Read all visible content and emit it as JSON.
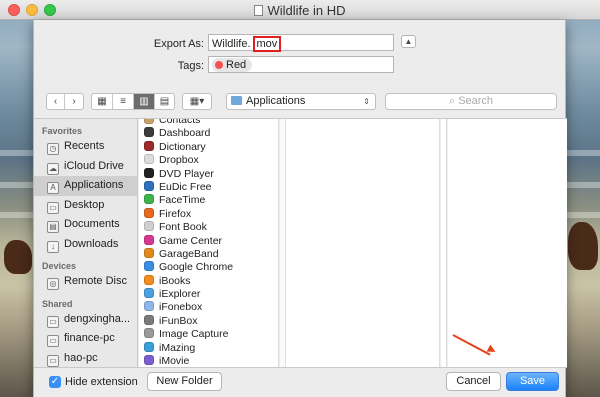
{
  "window": {
    "title": "Wildlife in HD"
  },
  "save": {
    "export_label": "Export As:",
    "filename_base": "Wildlife.",
    "filename_ext": "mov",
    "tags_label": "Tags:",
    "tag": "Red"
  },
  "toolbar": {
    "location": "Applications",
    "search_placeholder": "Search"
  },
  "sidebar": {
    "sections": [
      {
        "title": "Favorites",
        "items": [
          {
            "label": "Recents",
            "icon": "clock-icon"
          },
          {
            "label": "iCloud Drive",
            "icon": "cloud-icon"
          },
          {
            "label": "Applications",
            "icon": "applications-icon",
            "selected": true
          },
          {
            "label": "Desktop",
            "icon": "desktop-icon"
          },
          {
            "label": "Documents",
            "icon": "documents-icon"
          },
          {
            "label": "Downloads",
            "icon": "downloads-icon"
          }
        ]
      },
      {
        "title": "Devices",
        "items": [
          {
            "label": "Remote Disc",
            "icon": "disc-icon"
          }
        ]
      },
      {
        "title": "Shared",
        "items": [
          {
            "label": "dengxingha...",
            "icon": "computer-icon"
          },
          {
            "label": "finance-pc",
            "icon": "computer-icon"
          },
          {
            "label": "hao-pc",
            "icon": "computer-icon"
          }
        ]
      }
    ]
  },
  "apps": [
    {
      "label": "Contacts",
      "color": "#c8a16b"
    },
    {
      "label": "Dashboard",
      "color": "#3b3b3b"
    },
    {
      "label": "Dictionary",
      "color": "#9b2b2b"
    },
    {
      "label": "Dropbox",
      "color": "#dcdcdc"
    },
    {
      "label": "DVD Player",
      "color": "#222222"
    },
    {
      "label": "EuDic Free",
      "color": "#2f6fbf"
    },
    {
      "label": "FaceTime",
      "color": "#3db34a"
    },
    {
      "label": "Firefox",
      "color": "#e8681f"
    },
    {
      "label": "Font Book",
      "color": "#cfcfcf"
    },
    {
      "label": "Game Center",
      "color": "#d6388f"
    },
    {
      "label": "GarageBand",
      "color": "#e08b1e"
    },
    {
      "label": "Google Chrome",
      "color": "#3b8ee0"
    },
    {
      "label": "iBooks",
      "color": "#f28c1e"
    },
    {
      "label": "iExplorer",
      "color": "#4aa0e0"
    },
    {
      "label": "iFonebox",
      "color": "#8fb8e8"
    },
    {
      "label": "iFunBox",
      "color": "#7a7a7a"
    },
    {
      "label": "Image Capture",
      "color": "#9a9a9a"
    },
    {
      "label": "iMazing",
      "color": "#3aa0d8"
    },
    {
      "label": "iMovie",
      "color": "#7b5fd0"
    }
  ],
  "bottom": {
    "hide_extension_label": "Hide extension",
    "new_folder_label": "New Folder",
    "cancel_label": "Cancel",
    "save_label": "Save"
  },
  "colors": {
    "accent": "#1a82fb",
    "tag_red": "#f74f4f",
    "highlight_box": "#e02020",
    "annotation_arrow": "#e6421a"
  }
}
